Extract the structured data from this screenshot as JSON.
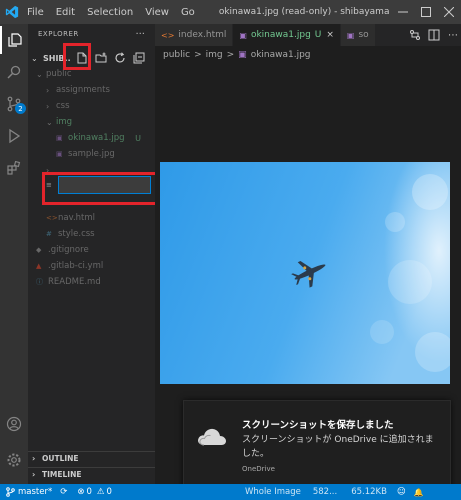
{
  "titlebar": {
    "menus": [
      "File",
      "Edit",
      "Selection",
      "View",
      "Go"
    ],
    "title": "okinawa1.jpg (read-only) - shibayama.i..."
  },
  "sidebar": {
    "title": "EXPLORER",
    "more": "...",
    "folder_name": "SHIB...",
    "tree": [
      {
        "label": "public",
        "type": "folder",
        "expanded": true
      },
      {
        "label": "assignments",
        "type": "folder",
        "expanded": false
      },
      {
        "label": "css",
        "type": "folder",
        "expanded": false
      },
      {
        "label": "img",
        "type": "folder",
        "expanded": true
      },
      {
        "label": "okinawa1.jpg",
        "type": "image",
        "status": "U"
      },
      {
        "label": "sample.jpg",
        "type": "image",
        "status": ""
      },
      {
        "label": "nav.html",
        "type": "html",
        "status": ""
      },
      {
        "label": "style.css",
        "type": "css",
        "status": ""
      },
      {
        "label": ".gitignore",
        "type": "file",
        "status": ""
      },
      {
        "label": ".gitlab-ci.yml",
        "type": "yml",
        "status": ""
      },
      {
        "label": "README.md",
        "type": "md",
        "status": ""
      }
    ],
    "new_file_value": "",
    "outline_label": "OUTLINE",
    "timeline_label": "TIMELINE"
  },
  "activity_badge": "2",
  "editor": {
    "tabs": [
      {
        "label": "index.html",
        "icon": "<>",
        "badge": "",
        "active": false
      },
      {
        "label": "okinawa1.jpg",
        "icon": "▣",
        "badge": "U",
        "active": true
      },
      {
        "label": "so",
        "icon": "▣",
        "badge": "",
        "active": false
      }
    ],
    "tab_close": "×",
    "breadcrumb": [
      "public",
      ">",
      "img",
      ">",
      "okinawa1.jpg"
    ]
  },
  "notification": {
    "title": "スクリーンショットを保存しました",
    "body": "スクリーンショットが OneDrive に追加されました。",
    "source": "OneDrive"
  },
  "statusbar": {
    "branch": "master*",
    "sync": "⟳",
    "errors": "0",
    "warnings": "0",
    "image_info_1": "Whole Image",
    "image_info_2": "582...",
    "image_size": "65.12KB",
    "feedback": "☺",
    "bell": "🔔"
  },
  "colors": {
    "accent": "#007acc",
    "highlight": "#e3242b",
    "git_untracked": "#73c991"
  }
}
